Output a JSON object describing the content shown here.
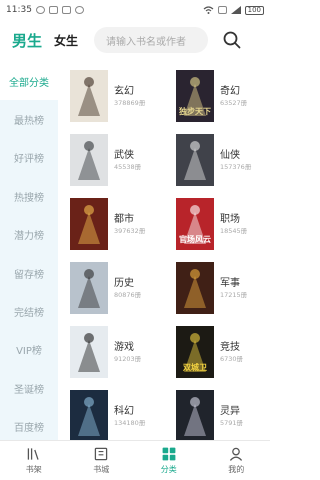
{
  "status": {
    "time": "11:35",
    "battery": "100"
  },
  "header": {
    "male_label": "男生",
    "female_label": "女生",
    "search_placeholder": "请输入书名或作者"
  },
  "sidebar": {
    "items": [
      {
        "label": "全部分类",
        "active": true
      },
      {
        "label": "最热榜"
      },
      {
        "label": "好评榜"
      },
      {
        "label": "热搜榜"
      },
      {
        "label": "潜力榜"
      },
      {
        "label": "留存榜"
      },
      {
        "label": "完结榜"
      },
      {
        "label": "VIP榜"
      },
      {
        "label": "圣诞榜"
      },
      {
        "label": "百度榜"
      }
    ]
  },
  "categories": [
    {
      "name": "玄幻",
      "count": "378869册",
      "cover_text": "",
      "cover_bg": "#e9e3d8",
      "cover_fg": "#3a2a20"
    },
    {
      "name": "奇幻",
      "count": "63527册",
      "cover_text": "独步天下",
      "cover_bg": "#2a2430",
      "cover_fg": "#e8d890"
    },
    {
      "name": "武侠",
      "count": "45538册",
      "cover_text": "",
      "cover_bg": "#dfe1e3",
      "cover_fg": "#2f3236"
    },
    {
      "name": "仙侠",
      "count": "157376册",
      "cover_text": "",
      "cover_bg": "#40424a",
      "cover_fg": "#e8e8e8"
    },
    {
      "name": "都市",
      "count": "397632册",
      "cover_text": "",
      "cover_bg": "#6a2218",
      "cover_fg": "#f5c050"
    },
    {
      "name": "职场",
      "count": "18545册",
      "cover_text": "官场风云",
      "cover_bg": "#b8242a",
      "cover_fg": "#ffffff"
    },
    {
      "name": "历史",
      "count": "80876册",
      "cover_text": "",
      "cover_bg": "#b8c2cc",
      "cover_fg": "#2a2a2a"
    },
    {
      "name": "军事",
      "count": "17215册",
      "cover_text": "",
      "cover_bg": "#402016",
      "cover_fg": "#f0b040"
    },
    {
      "name": "游戏",
      "count": "91203册",
      "cover_text": "",
      "cover_bg": "#e6ebef",
      "cover_fg": "#1a1a1a"
    },
    {
      "name": "竞技",
      "count": "6730册",
      "cover_text": "双城卫",
      "cover_bg": "#1c1a14",
      "cover_fg": "#f0d040"
    },
    {
      "name": "科幻",
      "count": "134180册",
      "cover_text": "",
      "cover_bg": "#1c2c40",
      "cover_fg": "#90c0e0"
    },
    {
      "name": "灵异",
      "count": "5791册",
      "cover_text": "",
      "cover_bg": "#20242c",
      "cover_fg": "#d8d8e8"
    }
  ],
  "tabs": [
    {
      "label": "书架",
      "icon": "bookshelf-icon"
    },
    {
      "label": "书城",
      "icon": "bookstore-icon"
    },
    {
      "label": "分类",
      "icon": "category-icon",
      "active": true
    },
    {
      "label": "我的",
      "icon": "profile-icon"
    }
  ],
  "colors": {
    "accent": "#1aa98d",
    "sidebar_bg": "#eef7fb"
  }
}
